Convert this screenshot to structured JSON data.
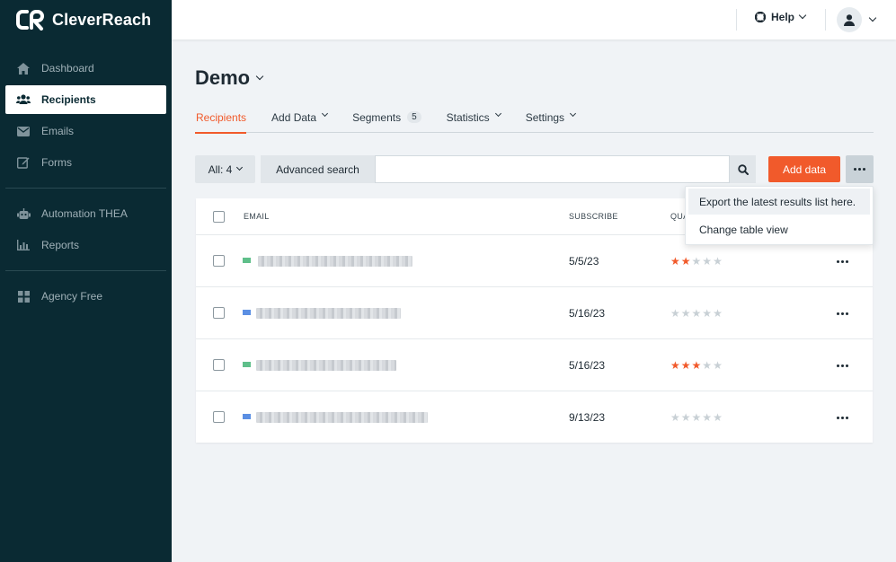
{
  "brand": {
    "name": "CleverReach"
  },
  "sidebar": {
    "items": [
      {
        "label": "Dashboard",
        "icon": "home-icon",
        "active": false
      },
      {
        "label": "Recipients",
        "icon": "users-icon",
        "active": true
      },
      {
        "label": "Emails",
        "icon": "envelope-icon",
        "active": false
      },
      {
        "label": "Forms",
        "icon": "edit-icon",
        "active": false
      },
      {
        "label": "Automation THEA",
        "icon": "robot-icon",
        "active": false
      },
      {
        "label": "Reports",
        "icon": "chart-icon",
        "active": false
      },
      {
        "label": "Agency Free",
        "icon": "grid-icon",
        "active": false
      }
    ]
  },
  "topbar": {
    "help_label": "Help"
  },
  "page": {
    "title": "Demo"
  },
  "tabs": [
    {
      "label": "Recipients",
      "active": true
    },
    {
      "label": "Add Data"
    },
    {
      "label": "Segments",
      "badge": "5"
    },
    {
      "label": "Statistics"
    },
    {
      "label": "Settings"
    }
  ],
  "toolbar": {
    "filter_label": "All: 4",
    "advanced_search_label": "Advanced search",
    "search_placeholder": "",
    "add_data_label": "Add data"
  },
  "table": {
    "columns": {
      "email": "EMAIL",
      "subscribe": "SUBSCRIBE",
      "quality": "QUALITY"
    },
    "rows": [
      {
        "source_color": "#5fbf8a",
        "date": "5/5/23",
        "stars": 2
      },
      {
        "source_color": "#5b8fe3",
        "date": "5/16/23",
        "stars": 0
      },
      {
        "source_color": "#5fbf8a",
        "date": "5/16/23",
        "stars": 3
      },
      {
        "source_color": "#5b8fe3",
        "date": "9/13/23",
        "stars": 0
      }
    ]
  },
  "dropdown": {
    "items": [
      {
        "label": "Export the latest results list here."
      },
      {
        "label": "Change table view"
      }
    ]
  },
  "colors": {
    "accent": "#f15a2b",
    "sidebar_bg": "#0a2a33"
  }
}
